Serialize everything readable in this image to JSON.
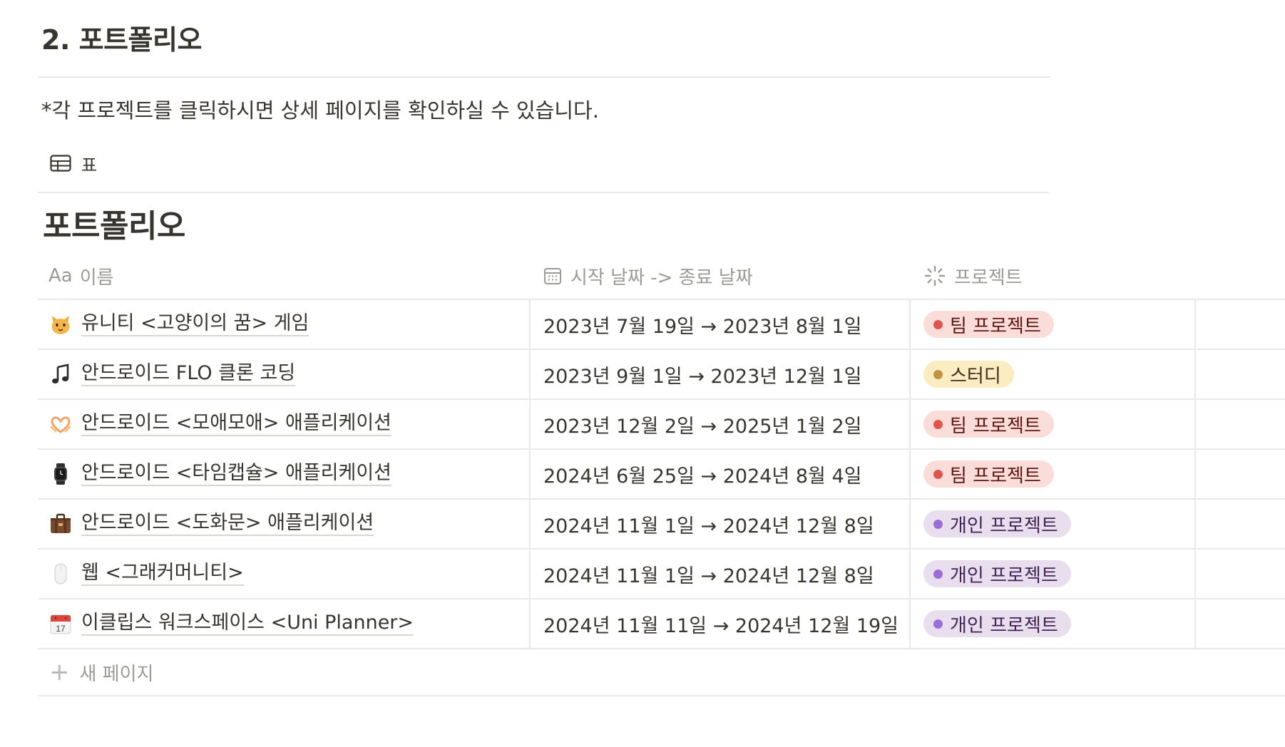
{
  "section": {
    "heading": "2. 포트폴리오",
    "intro": "*각 프로젝트를 클릭하시면 상세 페이지를 확인하실 수 있습니다."
  },
  "view": {
    "tab_label": "표",
    "tab_icon": "table-icon"
  },
  "database": {
    "title": "포트폴리오",
    "columns": [
      {
        "label": "이름",
        "prefix": "Aa",
        "icon": "text-type-icon"
      },
      {
        "label": "시작 날짜 -> 종료 날짜",
        "icon": "calendar-icon"
      },
      {
        "label": "프로젝트",
        "icon": "status-spinner-icon"
      }
    ],
    "rows": [
      {
        "icon": "cat-icon",
        "name": "유니티 <고양이의 꿈> 게임",
        "dates": "2023년 7월 19일 → 2023년 8월 1일",
        "project": "팀 프로젝트"
      },
      {
        "icon": "music-note-icon",
        "name": "안드로이드 FLO 클론 코딩",
        "dates": "2023년 9월 1일 → 2023년 12월 1일",
        "project": "스터디"
      },
      {
        "icon": "heart-hands-icon",
        "name": "안드로이드 <모애모애> 애플리케이션",
        "dates": "2023년 12월 2일 → 2025년 1월 2일",
        "project": "팀 프로젝트"
      },
      {
        "icon": "smartwatch-icon",
        "name": "안드로이드 <타임캡슐> 애플리케이션",
        "dates": "2024년 6월 25일 → 2024년 8월 4일",
        "project": "팀 프로젝트"
      },
      {
        "icon": "briefcase-icon",
        "name": "안드로이드 <도화문> 애플리케이션",
        "dates": "2024년 11월 1일 → 2024년 12월 8일",
        "project": "개인 프로젝트"
      },
      {
        "icon": "mouse-icon",
        "name": "웹 <그래커머니티>",
        "dates": "2024년 11월 1일 → 2024년 12월 8일",
        "project": "개인 프로젝트"
      },
      {
        "icon": "calendar-17-icon",
        "name": "이클립스 워크스페이스 <Uni Planner>",
        "dates": "2024년 11월 11일 → 2024년 12월 19일",
        "project": "개인 프로젝트"
      }
    ],
    "new_page_label": "새 페이지"
  },
  "calendar_day": "17",
  "tag_colors": {
    "팀 프로젝트": {
      "bg": "#fadcd9",
      "dot": "#de5550"
    },
    "스터디": {
      "bg": "#fbecc2",
      "dot": "#c29343"
    },
    "개인 프로젝트": {
      "bg": "#e8deee",
      "dot": "#9a6dd7"
    }
  }
}
